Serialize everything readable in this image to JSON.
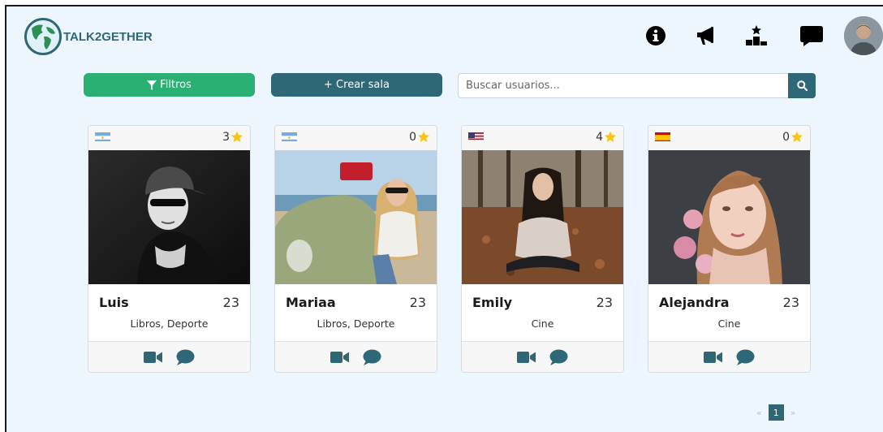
{
  "brand": {
    "name": "TALK2GETHER"
  },
  "nav": {
    "icons": [
      "info-icon",
      "megaphone-icon",
      "ranking-icon",
      "chat-icon"
    ]
  },
  "toolbar": {
    "filter_label": "Filtros",
    "create_label": "+ Crear sala",
    "search_placeholder": "Buscar usuarios..."
  },
  "cards": [
    {
      "name": "Luis",
      "age": "23",
      "interests": "Libros, Deporte",
      "rating": "3",
      "flag": "Argentina"
    },
    {
      "name": "Mariaa",
      "age": "23",
      "interests": "Libros, Deporte",
      "rating": "0",
      "flag": "Argentina"
    },
    {
      "name": "Emily",
      "age": "23",
      "interests": "Cine",
      "rating": "4",
      "flag": "USA"
    },
    {
      "name": "Alejandra",
      "age": "23",
      "interests": "Cine",
      "rating": "0",
      "flag": "España"
    }
  ],
  "pagination": {
    "prev": "«",
    "current": "1",
    "next": "»"
  },
  "colors": {
    "primary": "#2e6775",
    "success": "#2ab072",
    "star": "#f5c518",
    "background": "#eef6fd"
  }
}
